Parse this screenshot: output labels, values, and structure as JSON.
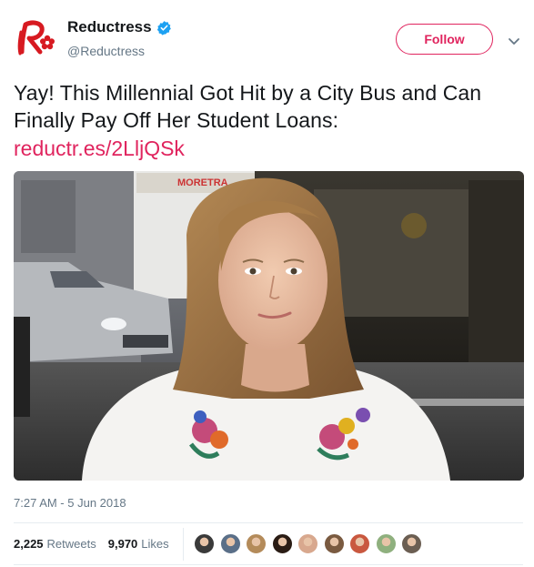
{
  "account": {
    "display_name": "Reductress",
    "handle": "@Reductress",
    "verified": true,
    "logo_icon": "reductress-logo-icon"
  },
  "actions": {
    "follow_label": "Follow",
    "menu_icon": "chevron-down-icon"
  },
  "tweet": {
    "text": "Yay! This Millennial Got Hit by a City Bus and Can Finally Pay Off Her Student Loans:",
    "link": "reductr.es/2LljQSk",
    "photo_description": "",
    "timestamp": "7:27 AM - 5 Jun 2018"
  },
  "stats": {
    "retweets_count": "2,225",
    "retweets_label": "Retweets",
    "likes_count": "9,970",
    "likes_label": "Likes"
  },
  "likers": [
    {
      "name": "liker-avatar-1",
      "color": "#3a3a3a"
    },
    {
      "name": "liker-avatar-2",
      "color": "#5a6f88"
    },
    {
      "name": "liker-avatar-3",
      "color": "#b48b5a"
    },
    {
      "name": "liker-avatar-4",
      "color": "#2a1c14"
    },
    {
      "name": "liker-avatar-5",
      "color": "#d8a88e"
    },
    {
      "name": "liker-avatar-6",
      "color": "#7a5a40"
    },
    {
      "name": "liker-avatar-7",
      "color": "#c9583f"
    },
    {
      "name": "liker-avatar-8",
      "color": "#8fb07e"
    },
    {
      "name": "liker-avatar-9",
      "color": "#6b5e52"
    }
  ],
  "colors": {
    "brand": "#e0245e",
    "verified": "#1da1f2",
    "muted_text": "#657786"
  }
}
